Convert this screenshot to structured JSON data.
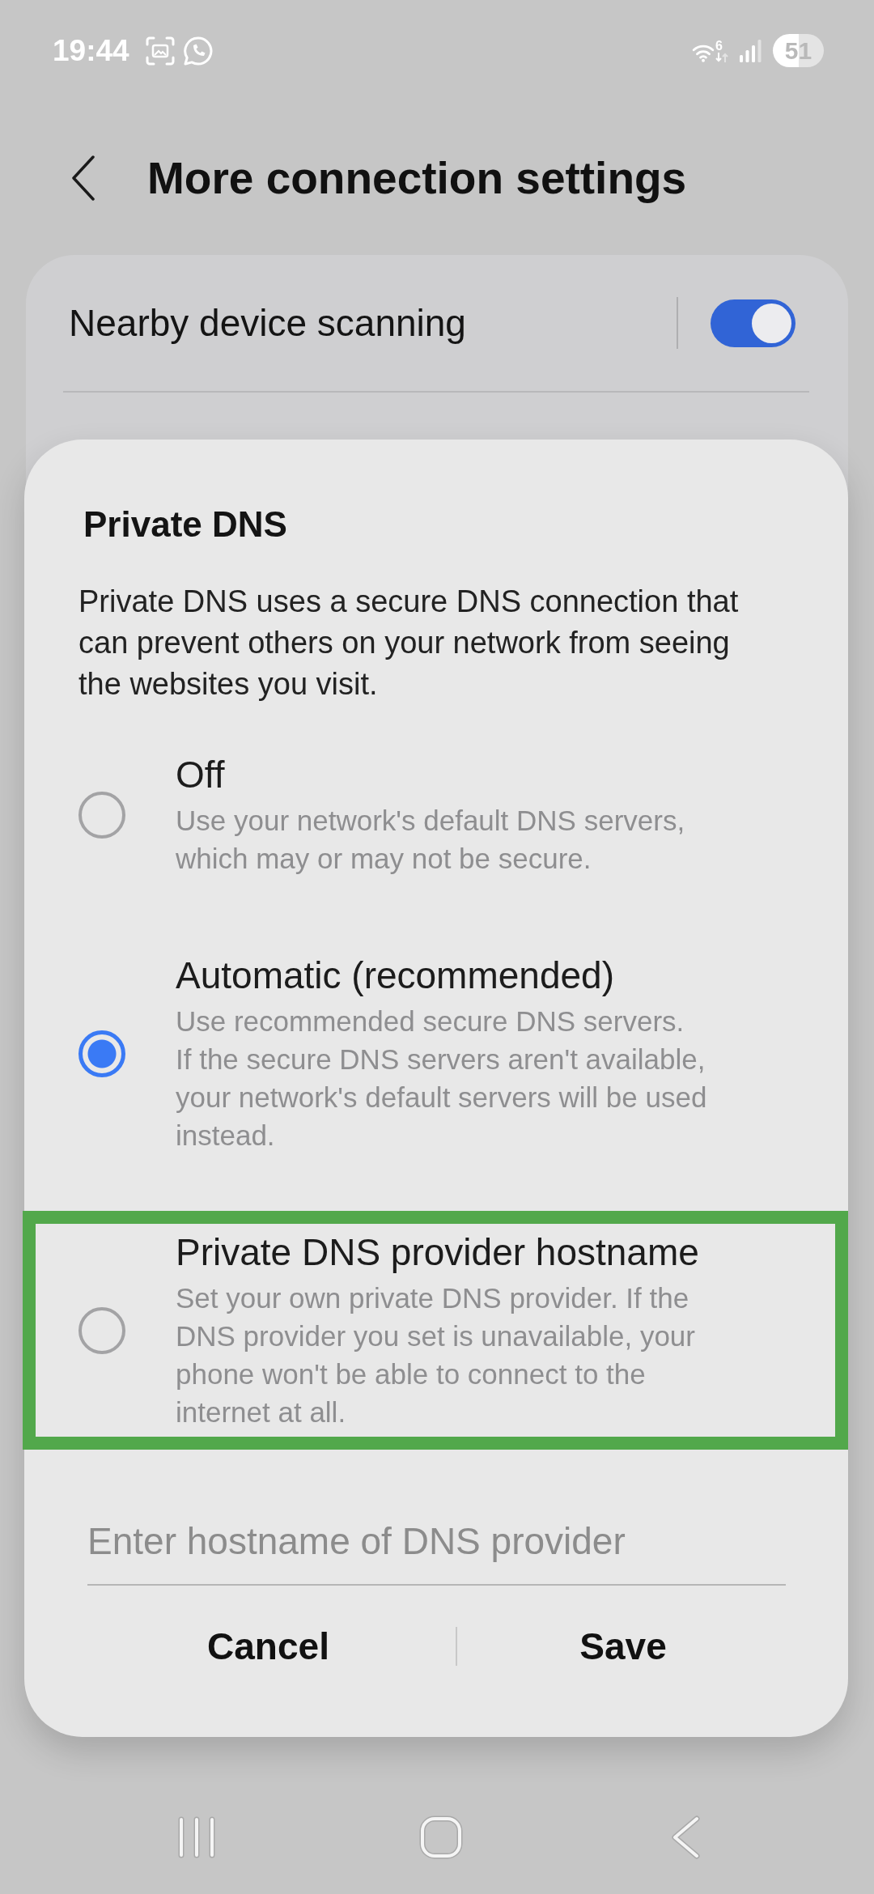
{
  "status_bar": {
    "time": "19:44",
    "wifi_label": "6",
    "battery": "51"
  },
  "header": {
    "title": "More connection settings"
  },
  "settings": [
    {
      "kind": "toggle",
      "label": "Nearby device scanning",
      "on": true
    }
  ],
  "dialog": {
    "title": "Private DNS",
    "description": "Private DNS uses a secure DNS connection that can prevent others on your network from seeing the websites you visit.",
    "options": [
      {
        "label": "Off",
        "description": "Use your network's default DNS servers, which may or may not be secure.",
        "selected": false,
        "highlighted": false
      },
      {
        "label": "Automatic (recommended)",
        "description": "Use recommended secure DNS servers.\nIf the secure DNS servers aren't available, your network's default servers will be used instead.",
        "selected": true,
        "highlighted": false
      },
      {
        "label": "Private DNS provider hostname",
        "description": "Set your own private DNS provider. If the DNS provider you set is unavailable, your phone won't be able to connect to the internet at all.",
        "selected": false,
        "highlighted": true
      }
    ],
    "hostname_field": {
      "placeholder": "Enter hostname of DNS provider"
    },
    "buttons": [
      {
        "label": "Cancel"
      },
      {
        "label": "Save"
      }
    ]
  }
}
